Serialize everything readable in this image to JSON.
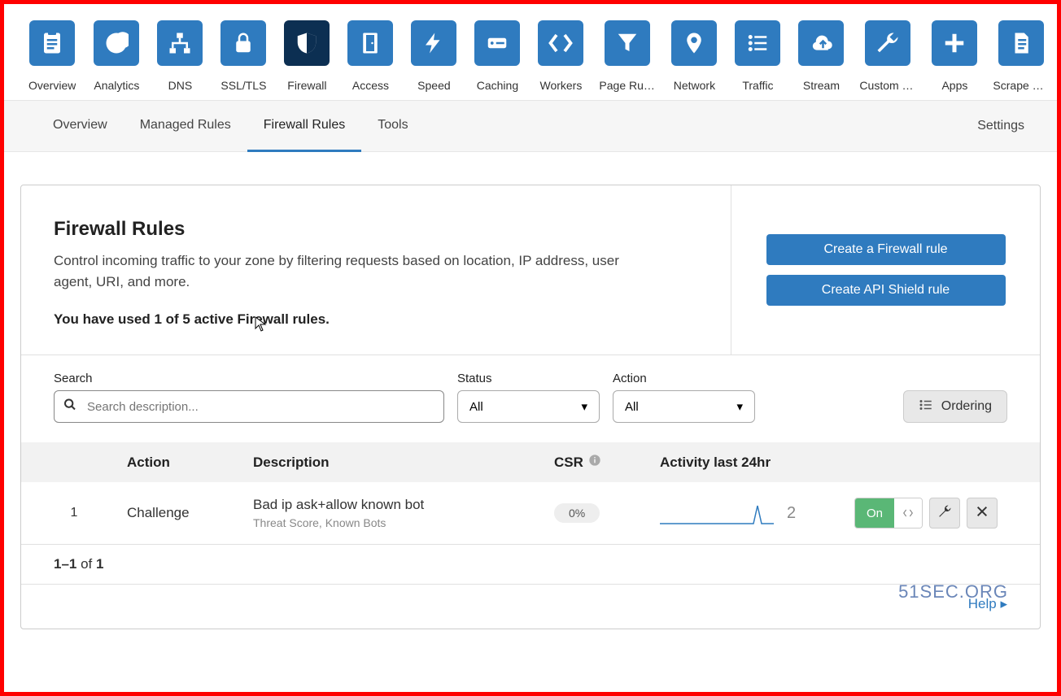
{
  "nav": [
    {
      "label": "Overview",
      "icon": "clipboard"
    },
    {
      "label": "Analytics",
      "icon": "pie"
    },
    {
      "label": "DNS",
      "icon": "sitemap"
    },
    {
      "label": "SSL/TLS",
      "icon": "lock"
    },
    {
      "label": "Firewall",
      "icon": "shield",
      "active": true
    },
    {
      "label": "Access",
      "icon": "door"
    },
    {
      "label": "Speed",
      "icon": "bolt"
    },
    {
      "label": "Caching",
      "icon": "drive"
    },
    {
      "label": "Workers",
      "icon": "angles"
    },
    {
      "label": "Page Rules",
      "icon": "funnel"
    },
    {
      "label": "Network",
      "icon": "pin"
    },
    {
      "label": "Traffic",
      "icon": "list"
    },
    {
      "label": "Stream",
      "icon": "cloud"
    },
    {
      "label": "Custom Pa...",
      "icon": "wrench"
    },
    {
      "label": "Apps",
      "icon": "plus"
    },
    {
      "label": "Scrape Shi...",
      "icon": "page"
    }
  ],
  "sub_tabs": {
    "items": [
      {
        "label": "Overview"
      },
      {
        "label": "Managed Rules"
      },
      {
        "label": "Firewall Rules",
        "active": true
      },
      {
        "label": "Tools"
      }
    ],
    "settings": "Settings"
  },
  "header": {
    "title": "Firewall Rules",
    "desc": "Control incoming traffic to your zone by filtering requests based on location, IP address, user agent, URI, and more.",
    "usage": "You have used 1 of 5 active Firewall rules.",
    "btn_create_rule": "Create a Firewall rule",
    "btn_create_api_shield": "Create API Shield rule"
  },
  "filters": {
    "search_label": "Search",
    "search_placeholder": "Search description...",
    "status_label": "Status",
    "status_value": "All",
    "action_label": "Action",
    "action_value": "All",
    "ordering": "Ordering"
  },
  "table": {
    "headers": {
      "action": "Action",
      "description": "Description",
      "csr": "CSR",
      "activity": "Activity last 24hr"
    },
    "rows": [
      {
        "index": "1",
        "action": "Challenge",
        "desc1": "Bad ip ask+allow known bot",
        "desc2": "Threat Score, Known Bots",
        "csr": "0%",
        "activity_count": "2",
        "toggle_on": "On"
      }
    ]
  },
  "pagination": {
    "range": "1–1",
    "of_word": " of ",
    "total": "1"
  },
  "help": "Help",
  "watermark": "51SEC.ORG"
}
